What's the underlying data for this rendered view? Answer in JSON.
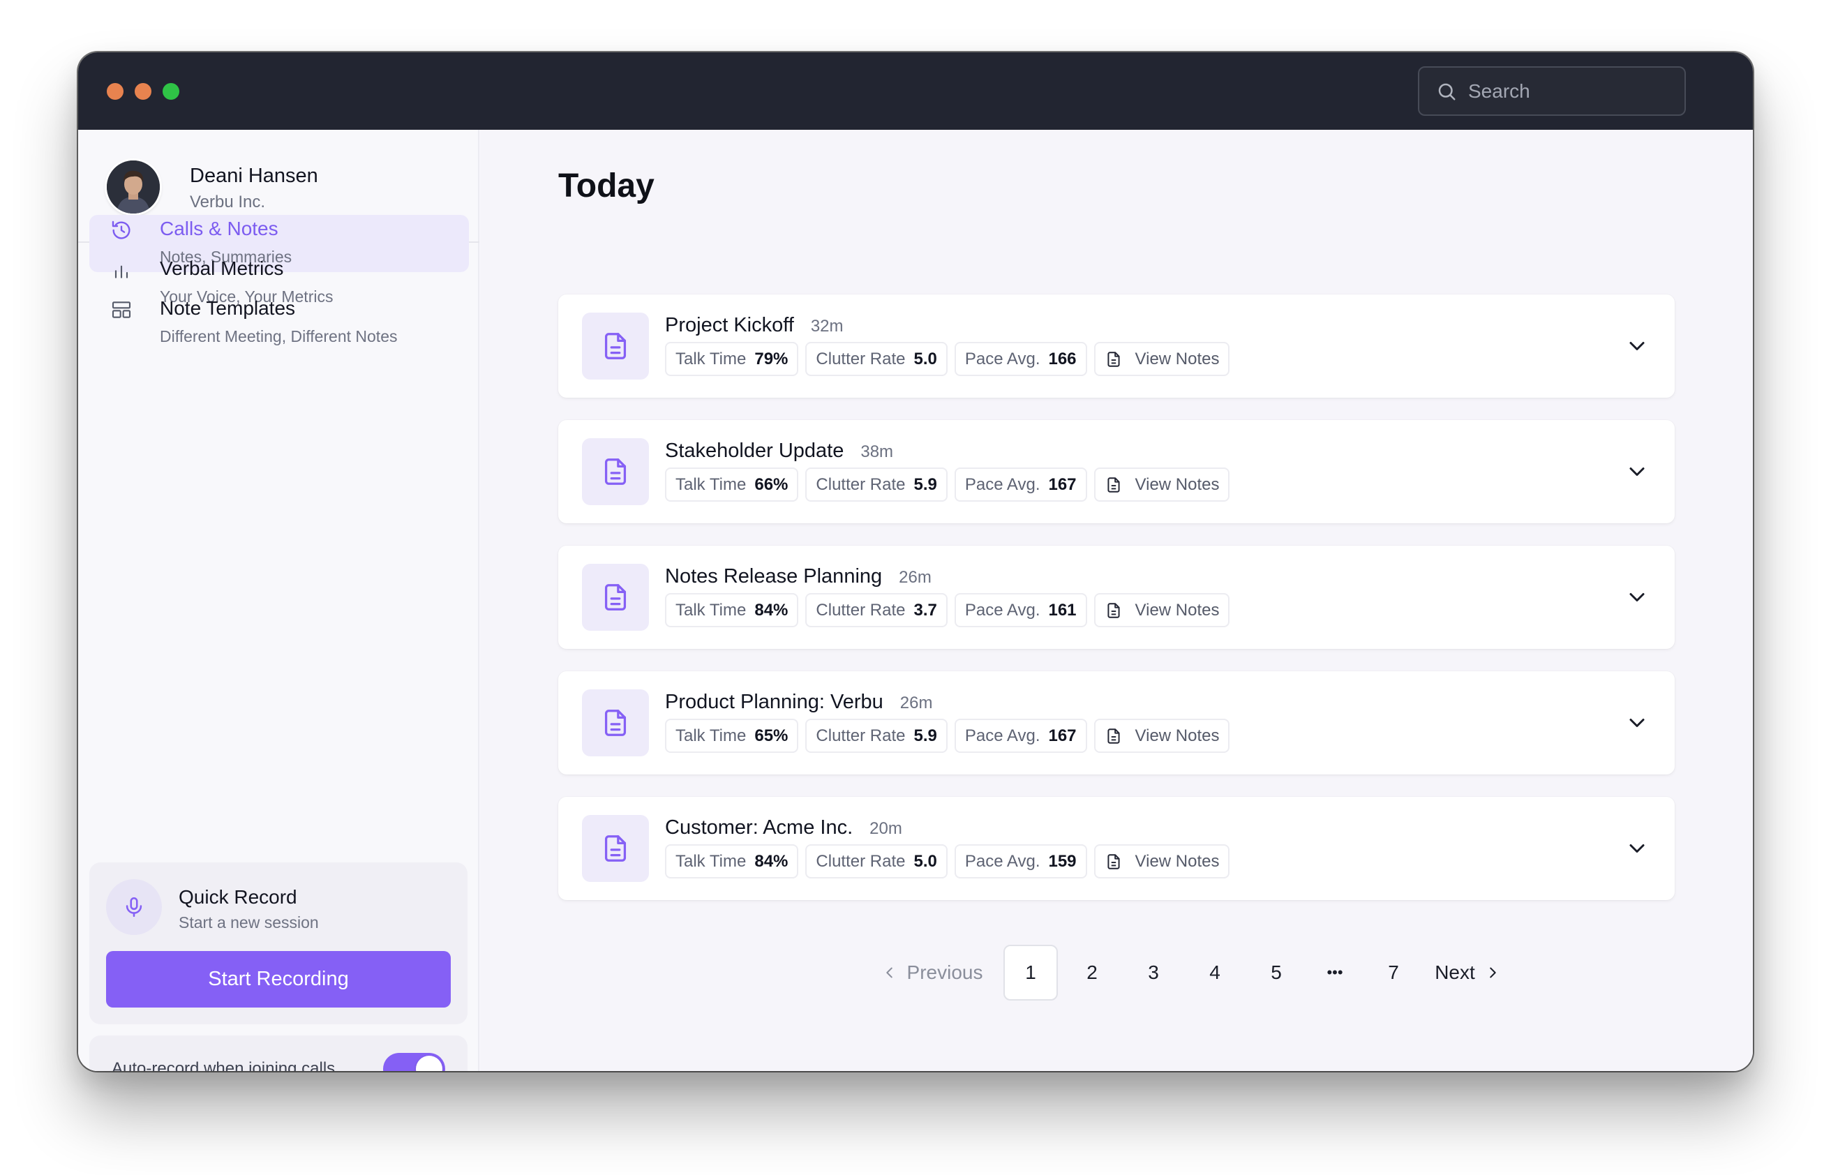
{
  "titlebar": {
    "search_placeholder": "Search"
  },
  "user": {
    "name": "Deani Hansen",
    "org": "Verbu Inc."
  },
  "sidebar": {
    "items": [
      {
        "label": "Calls & Notes",
        "sub": "Notes, Summaries",
        "icon": "history-icon",
        "active": true
      },
      {
        "label": "Verbal Metrics",
        "sub": "Your Voice, Your Metrics",
        "icon": "bar-chart-icon",
        "active": false
      },
      {
        "label": "Note Templates",
        "sub": "Different Meeting, Different Notes",
        "icon": "template-icon",
        "active": false
      }
    ]
  },
  "quick_record": {
    "title": "Quick Record",
    "subtitle": "Start a new session",
    "button": "Start Recording"
  },
  "auto_record": {
    "label": "Auto-record when joining calls",
    "enabled": true
  },
  "main": {
    "title": "Today",
    "labels": {
      "talk": "Talk Time",
      "clutter": "Clutter Rate",
      "pace": "Pace Avg.",
      "notes": "View Notes"
    },
    "calls": [
      {
        "title": "Project Kickoff",
        "duration": "32m",
        "talk": "79%",
        "clutter": "5.0",
        "pace": "166"
      },
      {
        "title": "Stakeholder Update",
        "duration": "38m",
        "talk": "66%",
        "clutter": "5.9",
        "pace": "167"
      },
      {
        "title": "Notes Release Planning",
        "duration": "26m",
        "talk": "84%",
        "clutter": "3.7",
        "pace": "161"
      },
      {
        "title": "Product Planning: Verbu",
        "duration": "26m",
        "talk": "65%",
        "clutter": "5.9",
        "pace": "167"
      },
      {
        "title": "Customer: Acme Inc.",
        "duration": "20m",
        "talk": "84%",
        "clutter": "5.0",
        "pace": "159"
      }
    ]
  },
  "pagination": {
    "previous": "Previous",
    "next": "Next",
    "pages": [
      "1",
      "2",
      "3",
      "4",
      "5",
      "7"
    ],
    "ellipsis": "•••",
    "current": "1"
  },
  "colors": {
    "accent": "#8560f5",
    "titlebar": "#222531",
    "traffic_light_orange": "#e8834f",
    "traffic_light_green": "#2fc346"
  }
}
